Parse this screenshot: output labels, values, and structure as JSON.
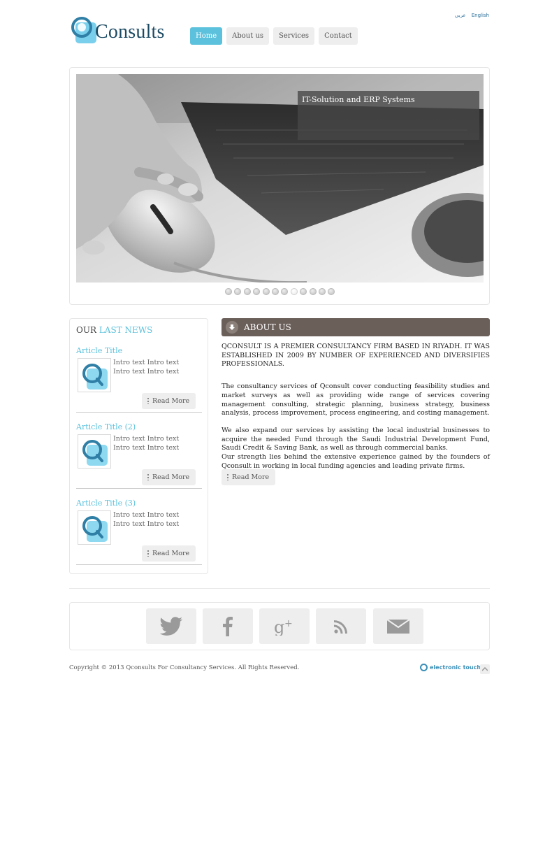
{
  "header": {
    "logo_text": "Consults",
    "nav": [
      {
        "label": "Home",
        "active": true
      },
      {
        "label": "About us",
        "active": false
      },
      {
        "label": "Services",
        "active": false
      },
      {
        "label": "Contact",
        "active": false
      }
    ],
    "languages": [
      "عربي",
      "English"
    ]
  },
  "slider": {
    "caption": "IT-Solution and ERP Systems",
    "slide_count": 12,
    "active_index": 7
  },
  "news": {
    "heading_prefix": "OUR",
    "heading_accent": "LAST NEWS",
    "articles": [
      {
        "title": "Article Title",
        "intro": "Intro text Intro text Intro text Intro text Intro  Full...",
        "read_more": "Read More"
      },
      {
        "title": "Article Title (2)",
        "intro": "Intro text Intro text Intro text Intro text Intro  Full...",
        "read_more": "Read More"
      },
      {
        "title": "Article Title (3)",
        "intro": "Intro text Intro text Intro text Intro text Intro  Full...",
        "read_more": "Read More"
      }
    ]
  },
  "about": {
    "title": "ABOUT US",
    "lead": "QCONSULT IS A PREMIER CONSULTANCY FIRM BASED IN RIYADH. IT WAS ESTABLISHED IN 2009 BY NUMBER OF EXPERIENCED AND DIVERSIFIES PROFESSIONALS.",
    "para1": "The consultancy services of Qconsult cover conducting feasibility studies and market surveys as well as providing wide range of services covering management consulting, strategic planning, business strategy, business analysis, process improvement, process engineering, and costing management.",
    "para2": "We also expand our services by assisting the local industrial businesses to acquire the needed Fund through the Saudi Industrial Development Fund, Saudi Credit & Saving Bank, as well as through commercial banks.",
    "para3": "Our strength lies behind the extensive experience gained by the founders of Qconsult in working in local funding agencies and leading private firms.",
    "read_more": "Read More"
  },
  "social": [
    "twitter-icon",
    "facebook-icon",
    "google-plus-icon",
    "rss-icon",
    "mail-icon"
  ],
  "footer": {
    "copyright": "Copyright © 2013 Qconsults For Consultancy Services. All Rights Reserved.",
    "credit": "electronic touch"
  },
  "colors": {
    "accent": "#5bc1dc",
    "about_header": "#6b5f5a",
    "logo_text": "#1c4a63"
  }
}
